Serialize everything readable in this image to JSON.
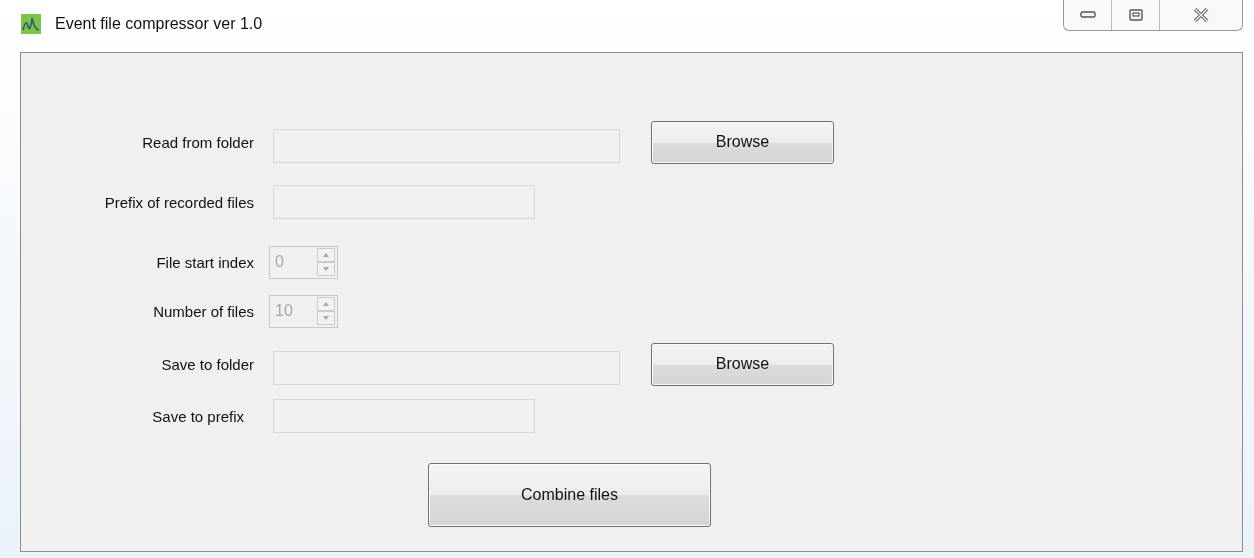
{
  "window": {
    "title": "Event file compressor ver 1.0"
  },
  "rows": [
    {
      "kind": "folder",
      "label": "Read from folder",
      "disabled": true,
      "button": "Browse"
    },
    {
      "kind": "text",
      "label": "Prefix of recorded files",
      "disabled": true
    },
    {
      "kind": "spinner",
      "label": "File start index",
      "value": "0",
      "disabled": true
    },
    {
      "kind": "spinner",
      "label": "Number of files",
      "value": "10",
      "disabled": true
    },
    {
      "kind": "folder",
      "label": "Save to folder",
      "disabled": true,
      "button": "Browse"
    },
    {
      "kind": "text",
      "label": "Save to prefix",
      "disabled": true
    }
  ],
  "action_button": "Combine files"
}
